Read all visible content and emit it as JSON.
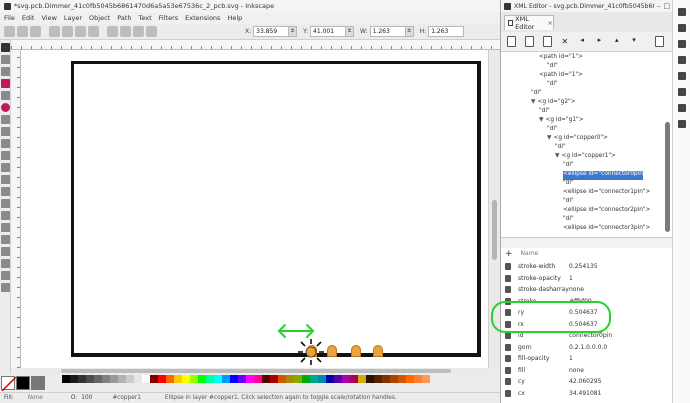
{
  "main": {
    "title": "*svg.pcb.Dimmer_41c0fb5045b6861470d6a5a53e67536c_2_pcb.svg - Inkscape",
    "menu": [
      "File",
      "Edit",
      "View",
      "Layer",
      "Object",
      "Path",
      "Text",
      "Filters",
      "Extensions",
      "Help"
    ],
    "coords": {
      "x_label": "X:",
      "x_value": "33.859",
      "y_label": "Y:",
      "y_value": "41.001",
      "w_label": "W:",
      "w_value": "1.263",
      "h_label": "H:",
      "h_value": "1.263"
    },
    "status": {
      "fill_label": "Fill:",
      "fill_value": "None",
      "opacity_label": "O:",
      "opacity_value": "100",
      "layer": "#copper1",
      "message": "Ellipse in layer #copper1. Click selection again to toggle scale/rotation handles."
    }
  },
  "xml_editor": {
    "title": "XML Editor - svg.pcb.Dimmer_41c0fb5045b6861470d6a...",
    "tab_label": "XML Editor",
    "tree": [
      {
        "text": "<path id=\"1\">",
        "indent": 3,
        "row": 0
      },
      {
        "text": "\"dl\"",
        "indent": 4,
        "row": 1
      },
      {
        "text": "<path id=\"1\">",
        "indent": 3,
        "row": 2
      },
      {
        "text": "\"dl\"",
        "indent": 4,
        "row": 3
      },
      {
        "text": "\"dl\"",
        "indent": 2,
        "row": 4
      },
      {
        "text": "<g id=\"g2\">",
        "indent": 2,
        "row": 5,
        "expander": "▼"
      },
      {
        "text": "\"dl\"",
        "indent": 3,
        "row": 6
      },
      {
        "text": "<g id=\"g1\">",
        "indent": 3,
        "row": 7,
        "expander": "▼"
      },
      {
        "text": "\"dl\"",
        "indent": 4,
        "row": 8
      },
      {
        "text": "<g id=\"copper0\">",
        "indent": 4,
        "row": 9,
        "expander": "▼"
      },
      {
        "text": "\"dl\"",
        "indent": 5,
        "row": 10
      },
      {
        "text": "<g id=\"copper1\">",
        "indent": 5,
        "row": 11,
        "expander": "▼"
      },
      {
        "text": "\"dl\"",
        "indent": 6,
        "row": 12
      },
      {
        "text": "<ellipse id=\"connector0pin\">",
        "indent": 6,
        "row": 13,
        "selected": true
      },
      {
        "text": "\"dl\"",
        "indent": 6,
        "row": 14
      },
      {
        "text": "<ellipse id=\"connector1pin\">",
        "indent": 6,
        "row": 15
      },
      {
        "text": "\"dl\"",
        "indent": 6,
        "row": 16
      },
      {
        "text": "<ellipse id=\"connector2pin\">",
        "indent": 6,
        "row": 17
      },
      {
        "text": "\"dl\"",
        "indent": 6,
        "row": 18
      },
      {
        "text": "<ellipse id=\"connector3pin\">",
        "indent": 6,
        "row": 19
      }
    ],
    "attr_header": "Name",
    "attributes": [
      {
        "name": "stroke-width",
        "value": "0.254135"
      },
      {
        "name": "stroke-opacity",
        "value": "1"
      },
      {
        "name": "stroke-dasharray",
        "value": "none"
      },
      {
        "name": "stroke",
        "value": "#ffbf00"
      },
      {
        "name": "ry",
        "value": "0.504637"
      },
      {
        "name": "rx",
        "value": "0.504637"
      },
      {
        "name": "id",
        "value": "connector0pin"
      },
      {
        "name": "gorn",
        "value": "0.2.1.0.0.0.0"
      },
      {
        "name": "fill-opacity",
        "value": "1"
      },
      {
        "name": "fill",
        "value": "none"
      },
      {
        "name": "cy",
        "value": "42.060295"
      },
      {
        "name": "cx",
        "value": "34.491081"
      }
    ]
  },
  "colors": {
    "accent": "#3d78cf",
    "annotation": "#2ad12a",
    "connector": "#e9a33a"
  }
}
